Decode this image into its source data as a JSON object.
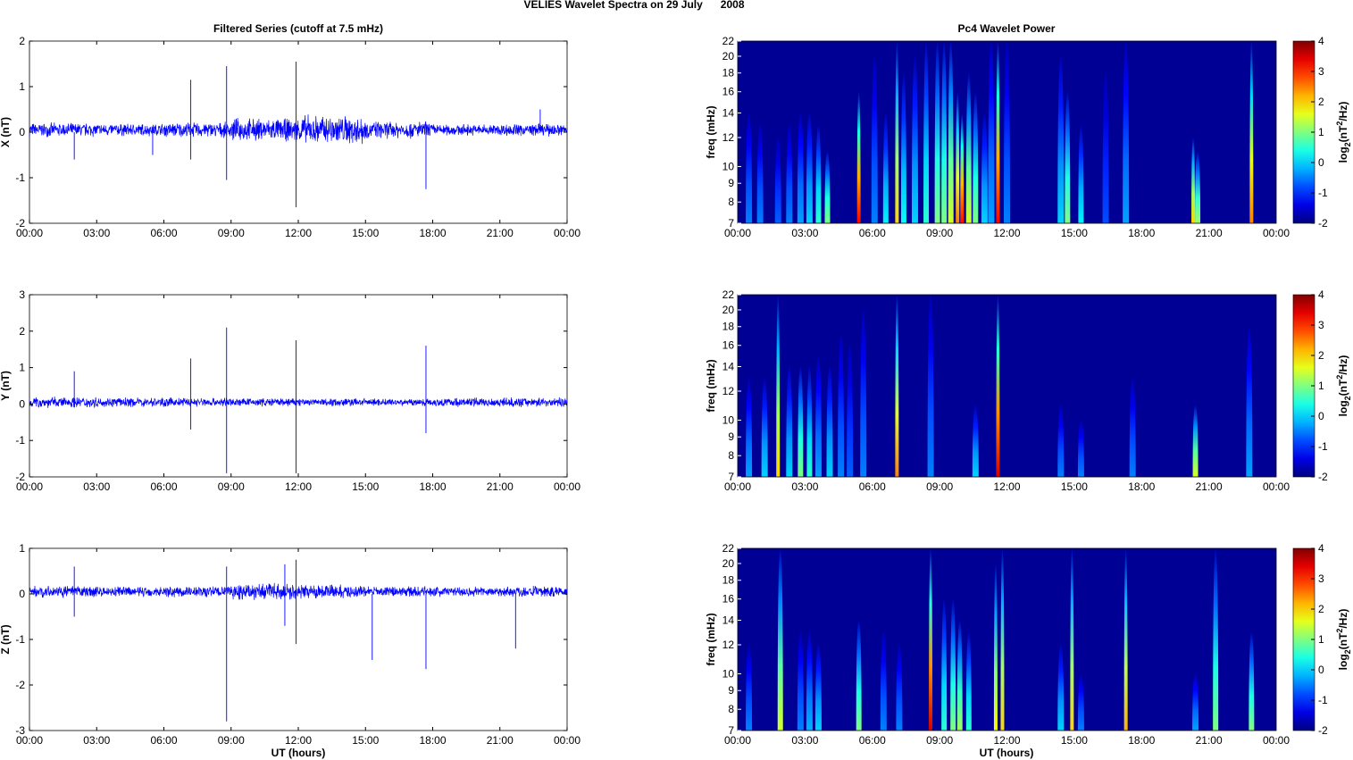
{
  "figure_title": "VELIES Wavelet Spectra on 29 July      2008",
  "chart_data": {
    "type": "line",
    "left_title": "Filtered Series (cutoff at 7.5 mHz)",
    "right_title": "Pc4 Wavelet Power",
    "xlabel": "UT (hours)",
    "x_ticks": [
      "00:00",
      "03:00",
      "06:00",
      "09:00",
      "12:00",
      "15:00",
      "18:00",
      "21:00",
      "00:00"
    ],
    "xlim_hours": [
      0,
      24
    ],
    "spectrogram_ylabel": "freq (mHz)",
    "freq_ticks": [
      7,
      8,
      9,
      10,
      12,
      14,
      16,
      18,
      20,
      22
    ],
    "freq_range_mHz": [
      7,
      22
    ],
    "freq_scale": "log",
    "colorbar": {
      "label": "log2(nT2/Hz)",
      "label_main": "log",
      "label_sub": "2",
      "label_rest": "(nT",
      "label_sup": "2",
      "label_end": "/Hz)",
      "ticks": [
        -2,
        -1,
        0,
        1,
        2,
        3,
        4
      ],
      "range": [
        -2,
        4
      ],
      "colormap": "jet"
    },
    "line_color": "#0000ff",
    "background_power": -2,
    "panels": [
      {
        "component": "X",
        "ylabel": "X (nT)",
        "ylim": [
          -2,
          2
        ],
        "y_ticks": [
          -2,
          -1,
          0,
          1,
          2
        ],
        "noise_amplitude_by_3h": [
          0.12,
          0.11,
          0.13,
          0.2,
          0.26,
          0.15,
          0.1,
          0.11
        ],
        "spikes": [
          [
            2.0,
            -0.6
          ],
          [
            5.5,
            -0.5
          ],
          [
            7.2,
            1.15
          ],
          [
            7.2,
            -0.6
          ],
          [
            8.8,
            1.45
          ],
          [
            8.8,
            -1.05
          ],
          [
            11.9,
            1.55
          ],
          [
            11.9,
            -1.65
          ],
          [
            17.7,
            -1.25
          ],
          [
            22.8,
            0.5
          ]
        ],
        "bursts": [
          [
            0.5,
            -0.5,
            14
          ],
          [
            1.0,
            -0.5,
            13
          ],
          [
            1.8,
            -0.7,
            12
          ],
          [
            2.3,
            -0.5,
            13
          ],
          [
            2.8,
            -0.3,
            14
          ],
          [
            3.2,
            0,
            14
          ],
          [
            3.6,
            0.5,
            13
          ],
          [
            4.0,
            1,
            11
          ],
          [
            5.4,
            3.3,
            16
          ],
          [
            6.1,
            -0.5,
            20
          ],
          [
            6.6,
            0.2,
            14
          ],
          [
            7.1,
            2.0,
            22
          ],
          [
            7.4,
            0.3,
            18
          ],
          [
            7.9,
            0,
            20
          ],
          [
            8.4,
            0.5,
            22
          ],
          [
            8.9,
            1.0,
            22
          ],
          [
            9.2,
            1.0,
            22
          ],
          [
            9.5,
            1.5,
            22
          ],
          [
            9.8,
            2.5,
            16
          ],
          [
            10.0,
            3.2,
            14
          ],
          [
            10.3,
            1.5,
            18
          ],
          [
            10.6,
            1.0,
            16
          ],
          [
            11.0,
            0,
            14
          ],
          [
            11.3,
            -0.3,
            22
          ],
          [
            11.6,
            3.3,
            22
          ],
          [
            12.0,
            -0.5,
            22
          ],
          [
            14.4,
            0,
            20
          ],
          [
            14.7,
            1,
            16
          ],
          [
            15.3,
            0.2,
            13
          ],
          [
            16.4,
            -0.8,
            18
          ],
          [
            17.3,
            -0.3,
            22
          ],
          [
            20.3,
            2,
            12
          ],
          [
            20.5,
            1.2,
            11
          ],
          [
            22.9,
            2.5,
            22
          ]
        ]
      },
      {
        "component": "Y",
        "ylabel": "Y (nT)",
        "ylim": [
          -2,
          3
        ],
        "y_ticks": [
          -2,
          -1,
          0,
          1,
          2,
          3
        ],
        "noise_amplitude_by_3h": [
          0.12,
          0.1,
          0.1,
          0.09,
          0.09,
          0.08,
          0.1,
          0.1
        ],
        "spikes": [
          [
            2.0,
            0.9
          ],
          [
            7.2,
            1.25
          ],
          [
            7.2,
            -0.7
          ],
          [
            8.8,
            2.1
          ],
          [
            8.8,
            -1.9
          ],
          [
            11.9,
            1.75
          ],
          [
            11.9,
            -1.9
          ],
          [
            17.7,
            1.6
          ],
          [
            17.7,
            -0.8
          ]
        ],
        "bursts": [
          [
            0.5,
            -0.3,
            13
          ],
          [
            1.2,
            0,
            13
          ],
          [
            1.8,
            2,
            22
          ],
          [
            2.3,
            0,
            14
          ],
          [
            2.8,
            1,
            14
          ],
          [
            3.2,
            0.5,
            14
          ],
          [
            3.6,
            -0.3,
            15
          ],
          [
            4.1,
            0,
            14
          ],
          [
            4.6,
            -0.5,
            17
          ],
          [
            5.0,
            -0.7,
            16
          ],
          [
            5.6,
            -0.5,
            20
          ],
          [
            7.1,
            2.5,
            22
          ],
          [
            8.6,
            -0.5,
            22
          ],
          [
            10.6,
            0,
            11
          ],
          [
            11.6,
            3.5,
            22
          ],
          [
            14.4,
            -0.5,
            11
          ],
          [
            15.3,
            -0.5,
            10
          ],
          [
            17.6,
            -0.5,
            13
          ],
          [
            20.4,
            1.5,
            11
          ],
          [
            22.8,
            -0.3,
            18
          ]
        ]
      },
      {
        "component": "Z",
        "ylabel": "Z (nT)",
        "ylim": [
          -3,
          1
        ],
        "y_ticks": [
          -3,
          -2,
          -1,
          0,
          1
        ],
        "noise_amplitude_by_3h": [
          0.1,
          0.09,
          0.1,
          0.14,
          0.12,
          0.09,
          0.09,
          0.1
        ],
        "spikes": [
          [
            2.0,
            0.6
          ],
          [
            2.0,
            -0.5
          ],
          [
            8.8,
            0.6
          ],
          [
            8.8,
            -2.8
          ],
          [
            11.4,
            0.65
          ],
          [
            11.4,
            -0.7
          ],
          [
            11.9,
            0.75
          ],
          [
            11.9,
            -1.1
          ],
          [
            15.3,
            -1.45
          ],
          [
            17.7,
            -1.65
          ],
          [
            21.7,
            -1.2
          ]
        ],
        "bursts": [
          [
            0.5,
            -0.5,
            12
          ],
          [
            1.9,
            1.5,
            22
          ],
          [
            2.8,
            -0.5,
            13
          ],
          [
            3.2,
            -0.2,
            13
          ],
          [
            3.6,
            0,
            12
          ],
          [
            5.4,
            1,
            14
          ],
          [
            6.5,
            -0.5,
            13
          ],
          [
            7.2,
            -0.5,
            12
          ],
          [
            8.6,
            3.5,
            22
          ],
          [
            9.2,
            0.5,
            16
          ],
          [
            9.6,
            1,
            16
          ],
          [
            9.9,
            1.2,
            14
          ],
          [
            10.3,
            0.5,
            13
          ],
          [
            11.5,
            1.8,
            20
          ],
          [
            11.8,
            2.0,
            22
          ],
          [
            14.4,
            0,
            12
          ],
          [
            14.9,
            2,
            22
          ],
          [
            15.3,
            -0.5,
            10
          ],
          [
            17.3,
            2.2,
            22
          ],
          [
            20.4,
            -0.3,
            10
          ],
          [
            21.3,
            1,
            22
          ],
          [
            22.9,
            1,
            13
          ]
        ]
      }
    ]
  }
}
